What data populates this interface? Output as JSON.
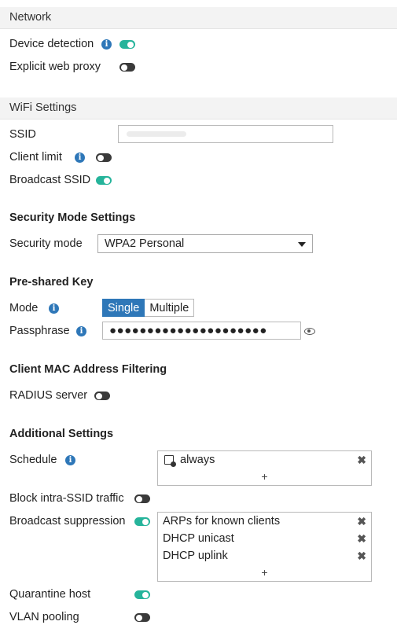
{
  "network": {
    "title": "Network",
    "device_detection": {
      "label": "Device detection",
      "enabled": true
    },
    "explicit_web_proxy": {
      "label": "Explicit web proxy",
      "enabled": false
    }
  },
  "wifi": {
    "title": "WiFi Settings",
    "ssid": {
      "label": "SSID",
      "value": ""
    },
    "client_limit": {
      "label": "Client limit",
      "enabled": false
    },
    "broadcast_ssid": {
      "label": "Broadcast SSID",
      "enabled": true
    }
  },
  "security": {
    "heading": "Security Mode Settings",
    "mode_label": "Security mode",
    "mode_value": "WPA2 Personal"
  },
  "psk": {
    "heading": "Pre-shared Key",
    "mode_label": "Mode",
    "options": [
      "Single",
      "Multiple"
    ],
    "selected": "Single",
    "passphrase_label": "Passphrase",
    "passphrase_mask": "●●●●●●●●●●●●●●●●●●●●●"
  },
  "mac_filter": {
    "heading": "Client MAC Address Filtering",
    "radius_label": "RADIUS server",
    "radius_enabled": false
  },
  "additional": {
    "heading": "Additional Settings",
    "schedule_label": "Schedule",
    "schedule_items": [
      "always"
    ],
    "block_intra_label": "Block intra-SSID traffic",
    "block_intra_enabled": false,
    "broadcast_supp_label": "Broadcast suppression",
    "broadcast_supp_enabled": true,
    "broadcast_supp_items": [
      "ARPs for known clients",
      "DHCP unicast",
      "DHCP uplink"
    ],
    "quarantine_label": "Quarantine host",
    "quarantine_enabled": true,
    "vlan_pooling_label": "VLAN pooling",
    "vlan_pooling_enabled": false
  },
  "icons": {
    "info": "i",
    "remove": "✖",
    "add": "+"
  },
  "colors": {
    "accent": "#2e77b8",
    "toggle_on": "#26b49b",
    "toggle_off": "#3a3a3a"
  }
}
